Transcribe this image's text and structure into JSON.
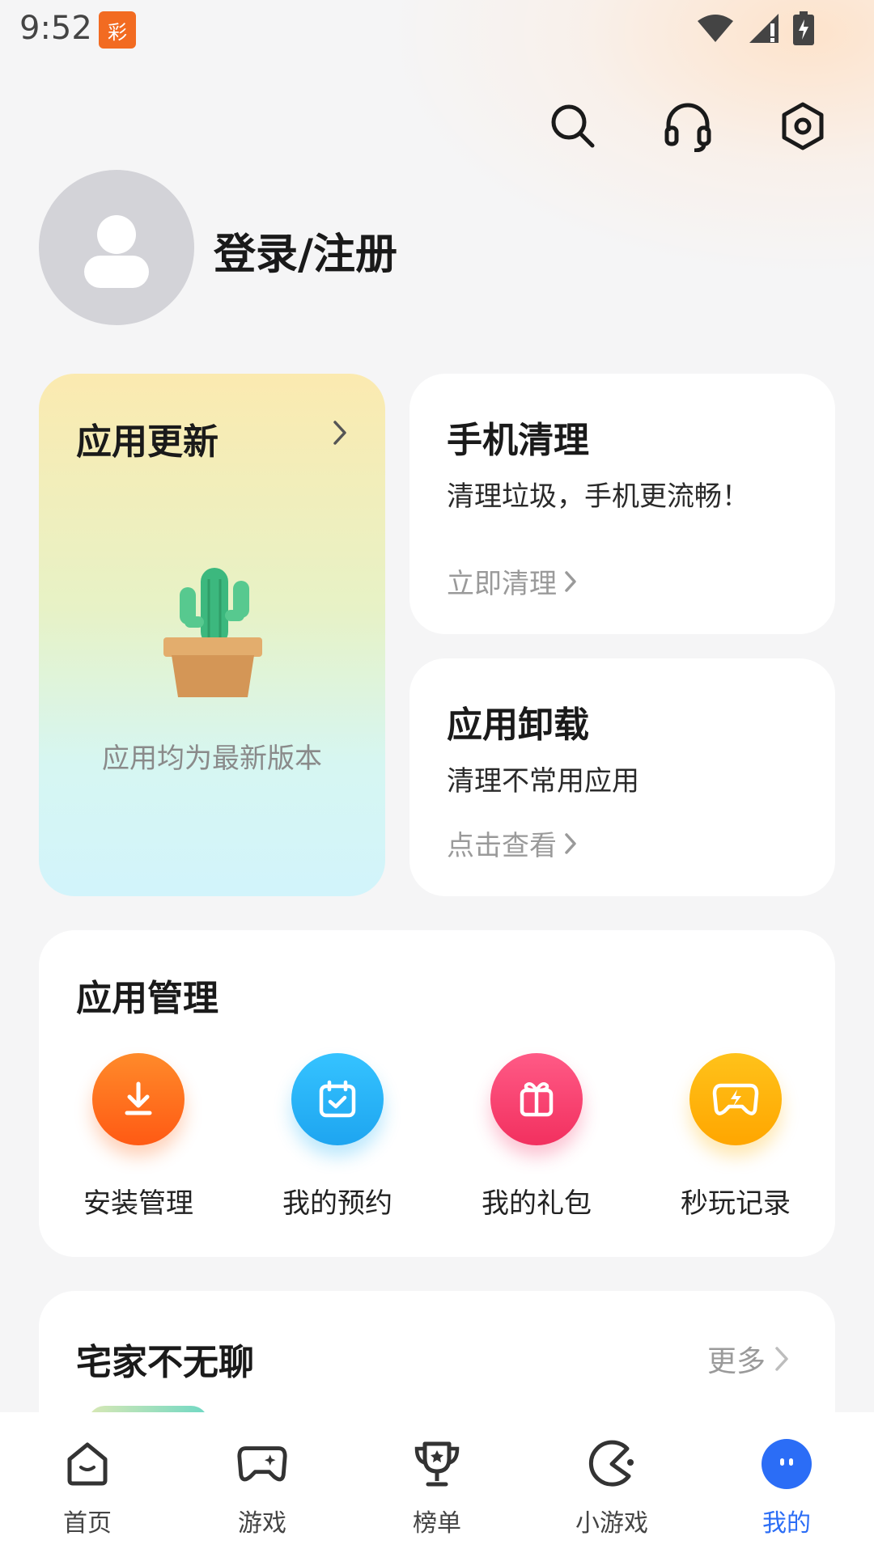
{
  "status_bar": {
    "time": "9:52",
    "notification_app": "彩"
  },
  "header": {
    "search_icon": "search-icon",
    "support_icon": "headset-icon",
    "settings_icon": "settings-icon"
  },
  "profile": {
    "login_label": "登录/注册"
  },
  "update_card": {
    "title": "应用更新",
    "empty_text": "应用均为最新版本"
  },
  "clean_card": {
    "title": "手机清理",
    "subtitle": "清理垃圾，手机更流畅！",
    "link": "立即清理"
  },
  "uninstall_card": {
    "title": "应用卸载",
    "subtitle": "清理不常用应用",
    "link": "点击查看"
  },
  "manage": {
    "title": "应用管理",
    "items": [
      {
        "label": "安装管理",
        "icon": "download-icon",
        "color": "#ff6a1a"
      },
      {
        "label": "我的预约",
        "icon": "calendar-icon",
        "color": "#22b4f5"
      },
      {
        "label": "我的礼包",
        "icon": "gift-icon",
        "color": "#f53d6e"
      },
      {
        "label": "秒玩记录",
        "icon": "flash-game-icon",
        "color": "#ffb300"
      }
    ]
  },
  "fun_section": {
    "title": "宅家不无聊",
    "more": "更多"
  },
  "bottom_nav": {
    "items": [
      {
        "label": "首页",
        "icon": "home-icon"
      },
      {
        "label": "游戏",
        "icon": "gamepad-icon"
      },
      {
        "label": "榜单",
        "icon": "trophy-icon"
      },
      {
        "label": "小游戏",
        "icon": "pacman-icon"
      },
      {
        "label": "我的",
        "icon": "profile-icon",
        "active": true
      }
    ]
  },
  "colors": {
    "accent": "#2b6df6",
    "background": "#f5f5f6"
  }
}
